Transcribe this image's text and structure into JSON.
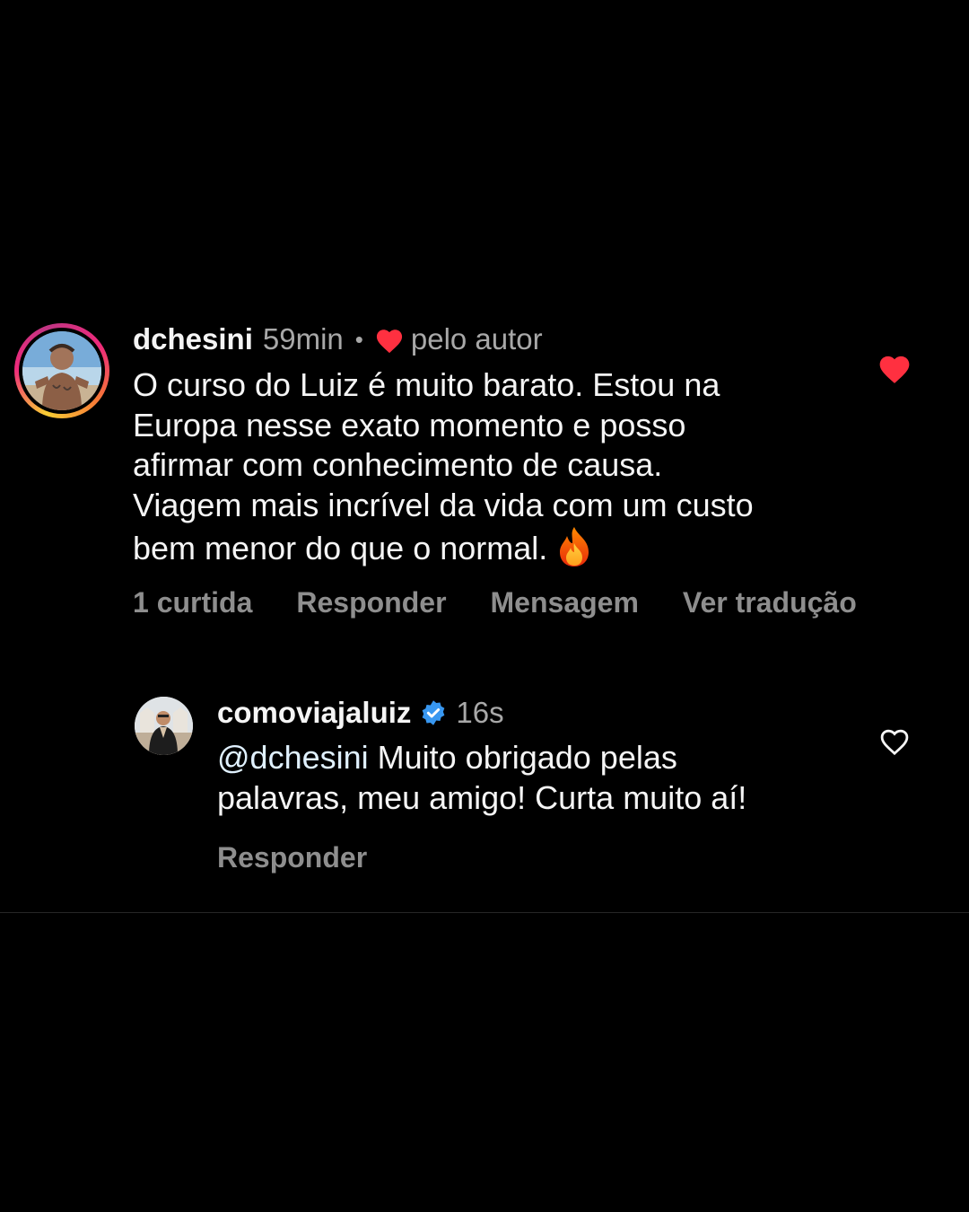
{
  "comment": {
    "username": "dchesini",
    "timestamp": "59min",
    "separator": "•",
    "author_like_label": "pelo autor",
    "text": "O curso do Luiz é muito barato. Estou na\nEuropa nesse exato momento e posso\nafirmar com conhecimento de causa.\nViagem mais incrível da vida com um custo\nbem menor do que o normal.",
    "emoji_icon": "fire-icon",
    "liked": true,
    "actions": {
      "likes": "1 curtida",
      "reply": "Responder",
      "message": "Mensagem",
      "translate": "Ver tradução"
    }
  },
  "reply": {
    "username": "comoviajaluiz",
    "verified": true,
    "timestamp": "16s",
    "mention": "@dchesini",
    "text": " Muito obrigado pelas\npalavras, meu amigo! Curta muito aí!",
    "liked": false,
    "reply_action": "Responder"
  },
  "colors": {
    "background": "#000000",
    "primary_text": "#f5f5f5",
    "secondary_text": "#a8a8a8",
    "action_text": "#8e8e8e",
    "like_red": "#ff3040",
    "verified_blue": "#3897f0"
  }
}
